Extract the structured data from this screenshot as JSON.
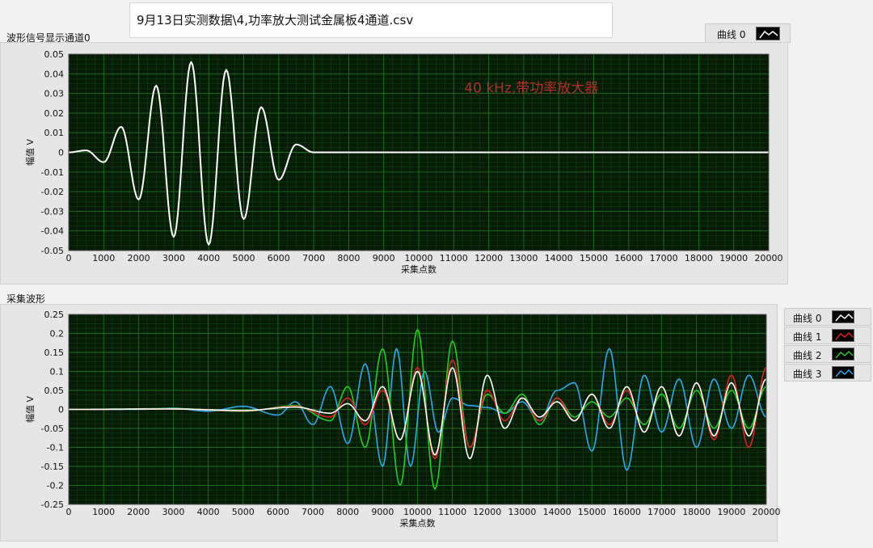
{
  "file_path": "9月13日实测数据\\4,功率放大测试金属板4通道.csv",
  "graph1": {
    "label": "波形信号显示通道0",
    "annotation": "40 kHz,带功率放大器",
    "legend": [
      {
        "name": "曲线 0",
        "color": "#ffffff"
      }
    ]
  },
  "graph2": {
    "label": "采集波形",
    "legend": [
      {
        "name": "曲线 0",
        "color": "#ffffff"
      },
      {
        "name": "曲线 1",
        "color": "#e02020"
      },
      {
        "name": "曲线 2",
        "color": "#22cc22"
      },
      {
        "name": "曲线 3",
        "color": "#29aaee"
      }
    ]
  },
  "colors": {
    "plot_bg": "#071c07",
    "grid": "#1f7a1f",
    "annotation": "#b32d2d"
  },
  "chart_data": [
    {
      "type": "line",
      "xlabel": "采集点数",
      "ylabel": "幅值 V",
      "xlim": [
        0,
        20000
      ],
      "ylim": [
        -0.05,
        0.05
      ],
      "xticks": [
        0,
        1000,
        2000,
        3000,
        4000,
        5000,
        6000,
        7000,
        8000,
        9000,
        10000,
        11000,
        12000,
        13000,
        14000,
        15000,
        16000,
        17000,
        18000,
        19000,
        20000
      ],
      "yticks": [
        "0.05",
        "0.04",
        "0.03",
        "0.02",
        "0.01",
        "0",
        "-0.01",
        "-0.02",
        "-0.03",
        "-0.04",
        "-0.05"
      ],
      "grid": true,
      "series": [
        {
          "name": "曲线 0",
          "color": "#ffffff",
          "points": [
            [
              0,
              0
            ],
            [
              500,
              0.001
            ],
            [
              1000,
              -0.005
            ],
            [
              1500,
              0.013
            ],
            [
              2000,
              -0.024
            ],
            [
              2500,
              0.034
            ],
            [
              3000,
              -0.043
            ],
            [
              3500,
              0.046
            ],
            [
              4000,
              -0.047
            ],
            [
              4500,
              0.042
            ],
            [
              5000,
              -0.034
            ],
            [
              5500,
              0.023
            ],
            [
              6000,
              -0.014
            ],
            [
              6500,
              0.004
            ],
            [
              7000,
              0
            ],
            [
              20000,
              0
            ]
          ]
        }
      ]
    },
    {
      "type": "line",
      "xlabel": "采集点数",
      "ylabel": "幅值 V",
      "xlim": [
        0,
        20000
      ],
      "ylim": [
        -0.25,
        0.25
      ],
      "xticks": [
        0,
        1000,
        2000,
        3000,
        4000,
        5000,
        6000,
        7000,
        8000,
        9000,
        10000,
        11000,
        12000,
        13000,
        14000,
        15000,
        16000,
        17000,
        18000,
        19000,
        20000
      ],
      "yticks": [
        "0.25",
        "0.2",
        "0.15",
        "0.1",
        "0.05",
        "0",
        "-0.05",
        "-0.1",
        "-0.15",
        "-0.2",
        "-0.25"
      ],
      "grid": true,
      "series": [
        {
          "name": "曲线 3",
          "color": "#29aaee",
          "points": [
            [
              0,
              0
            ],
            [
              2000,
              0
            ],
            [
              3000,
              0.003
            ],
            [
              4000,
              -0.005
            ],
            [
              5000,
              0.008
            ],
            [
              6000,
              -0.015
            ],
            [
              6500,
              0.02
            ],
            [
              7000,
              -0.04
            ],
            [
              7500,
              0.06
            ],
            [
              8000,
              -0.09
            ],
            [
              8500,
              0.12
            ],
            [
              9000,
              -0.15
            ],
            [
              9400,
              0.16
            ],
            [
              9800,
              -0.15
            ],
            [
              10200,
              0.1
            ],
            [
              10600,
              -0.06
            ],
            [
              11000,
              0.03
            ],
            [
              11500,
              0.01
            ],
            [
              12000,
              0.005
            ],
            [
              12500,
              -0.01
            ],
            [
              13000,
              0.02
            ],
            [
              13500,
              -0.03
            ],
            [
              14000,
              0.05
            ],
            [
              14500,
              0.07
            ],
            [
              15000,
              -0.11
            ],
            [
              15500,
              0.16
            ],
            [
              16000,
              -0.16
            ],
            [
              16500,
              0.09
            ],
            [
              17000,
              -0.06
            ],
            [
              17500,
              0.08
            ],
            [
              18000,
              -0.1
            ],
            [
              18500,
              0.08
            ],
            [
              19000,
              -0.05
            ],
            [
              19500,
              0.09
            ],
            [
              20000,
              -0.02
            ]
          ]
        },
        {
          "name": "曲线 2",
          "color": "#22cc22",
          "points": [
            [
              0,
              0
            ],
            [
              3000,
              0.002
            ],
            [
              5000,
              -0.005
            ],
            [
              6500,
              0.01
            ],
            [
              7500,
              -0.03
            ],
            [
              8000,
              0.06
            ],
            [
              8500,
              -0.1
            ],
            [
              9000,
              0.16
            ],
            [
              9500,
              -0.2
            ],
            [
              10000,
              0.21
            ],
            [
              10500,
              -0.21
            ],
            [
              11000,
              0.18
            ],
            [
              11500,
              -0.1
            ],
            [
              12000,
              0.04
            ],
            [
              12500,
              -0.01
            ],
            [
              13000,
              0.04
            ],
            [
              13500,
              -0.04
            ],
            [
              14000,
              0.03
            ],
            [
              14500,
              -0.02
            ],
            [
              15000,
              0.02
            ],
            [
              15500,
              -0.02
            ],
            [
              16000,
              0.03
            ],
            [
              16500,
              -0.04
            ],
            [
              17000,
              0.04
            ],
            [
              17500,
              -0.05
            ],
            [
              18000,
              0.05
            ],
            [
              18500,
              -0.05
            ],
            [
              19000,
              0.05
            ],
            [
              19500,
              -0.05
            ],
            [
              20000,
              0.06
            ]
          ]
        },
        {
          "name": "曲线 1",
          "color": "#e02020",
          "points": [
            [
              0,
              0
            ],
            [
              3000,
              0.001
            ],
            [
              5000,
              -0.004
            ],
            [
              6500,
              0.008
            ],
            [
              7500,
              -0.02
            ],
            [
              8000,
              0.03
            ],
            [
              8500,
              -0.04
            ],
            [
              9000,
              0.05
            ],
            [
              9500,
              -0.08
            ],
            [
              10000,
              0.11
            ],
            [
              10500,
              -0.13
            ],
            [
              11000,
              0.13
            ],
            [
              11500,
              -0.1
            ],
            [
              12000,
              0.05
            ],
            [
              12500,
              -0.03
            ],
            [
              13000,
              0.03
            ],
            [
              13500,
              -0.03
            ],
            [
              14000,
              0.03
            ],
            [
              14500,
              -0.03
            ],
            [
              15000,
              0.04
            ],
            [
              15500,
              -0.04
            ],
            [
              16000,
              0.05
            ],
            [
              16500,
              -0.06
            ],
            [
              17000,
              0.06
            ],
            [
              17500,
              -0.07
            ],
            [
              18000,
              0.07
            ],
            [
              18500,
              -0.08
            ],
            [
              19000,
              0.09
            ],
            [
              19500,
              -0.1
            ],
            [
              20000,
              0.11
            ]
          ]
        },
        {
          "name": "曲线 0",
          "color": "#ffffff",
          "points": [
            [
              0,
              0
            ],
            [
              3000,
              0.001
            ],
            [
              5000,
              -0.003
            ],
            [
              6500,
              0.006
            ],
            [
              7500,
              -0.01
            ],
            [
              8000,
              0.015
            ],
            [
              8500,
              -0.03
            ],
            [
              9000,
              0.06
            ],
            [
              9500,
              -0.08
            ],
            [
              10000,
              0.1
            ],
            [
              10500,
              -0.12
            ],
            [
              11000,
              0.11
            ],
            [
              11500,
              -0.13
            ],
            [
              12000,
              0.09
            ],
            [
              12500,
              -0.05
            ],
            [
              13000,
              0.03
            ],
            [
              13500,
              -0.02
            ],
            [
              14000,
              0.02
            ],
            [
              14500,
              -0.03
            ],
            [
              15000,
              0.04
            ],
            [
              15500,
              -0.05
            ],
            [
              16000,
              0.06
            ],
            [
              16500,
              -0.06
            ],
            [
              17000,
              0.06
            ],
            [
              17500,
              -0.07
            ],
            [
              18000,
              0.07
            ],
            [
              18500,
              -0.07
            ],
            [
              19000,
              0.07
            ],
            [
              19500,
              -0.07
            ],
            [
              20000,
              0.08
            ]
          ]
        }
      ]
    }
  ]
}
